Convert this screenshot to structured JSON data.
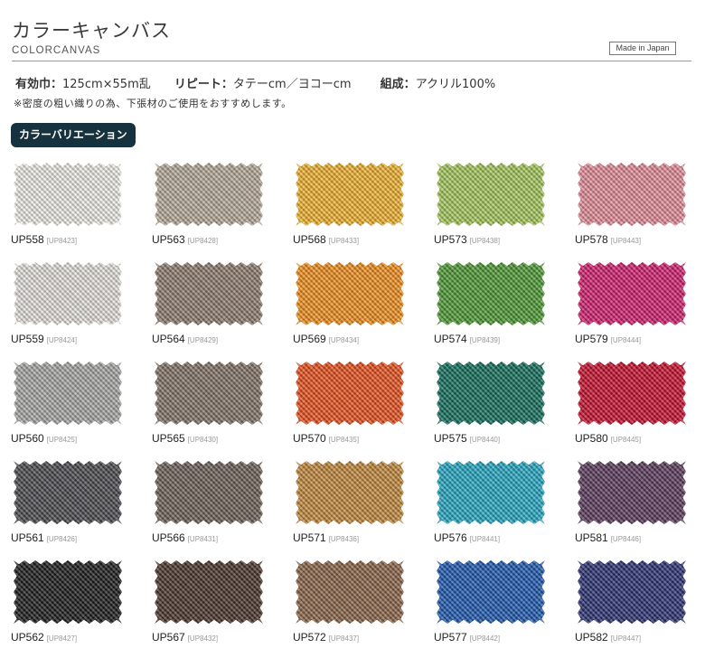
{
  "header": {
    "title": "カラーキャンバス",
    "subtitle": "COLORCANVAS",
    "badge": "Made in Japan"
  },
  "specs": {
    "width_label": "有効巾：",
    "width_value": "125cm×55m乱",
    "repeat_label": "リピート：",
    "repeat_value": "タテーcm／ヨコーcm",
    "composition_label": "組成：",
    "composition_value": "アクリル100%"
  },
  "note": "※密度の粗い織りの為、下張材のご使用をおすすめします。",
  "section_tab": "カラーバリエーション",
  "swatches": [
    {
      "code": "UP558",
      "sub": "[UP8423]",
      "color": "#f1efe9"
    },
    {
      "code": "UP563",
      "sub": "[UP8428]",
      "color": "#b8ab9b"
    },
    {
      "code": "UP568",
      "sub": "[UP8433]",
      "color": "#f2b431"
    },
    {
      "code": "UP573",
      "sub": "[UP8438]",
      "color": "#a6c95d"
    },
    {
      "code": "UP578",
      "sub": "[UP8443]",
      "color": "#e58e9b"
    },
    {
      "code": "UP559",
      "sub": "[UP8424]",
      "color": "#e7e4df"
    },
    {
      "code": "UP564",
      "sub": "[UP8429]",
      "color": "#8f7d70"
    },
    {
      "code": "UP569",
      "sub": "[UP8434]",
      "color": "#f2911f"
    },
    {
      "code": "UP574",
      "sub": "[UP8439]",
      "color": "#4f9a35"
    },
    {
      "code": "UP579",
      "sub": "[UP8444]",
      "color": "#d3206f"
    },
    {
      "code": "UP560",
      "sub": "[UP8425]",
      "color": "#a9a9a6"
    },
    {
      "code": "UP565",
      "sub": "[UP8430]",
      "color": "#837468"
    },
    {
      "code": "UP570",
      "sub": "[UP8435]",
      "color": "#e9521f"
    },
    {
      "code": "UP575",
      "sub": "[UP8440]",
      "color": "#13705c"
    },
    {
      "code": "UP580",
      "sub": "[UP8445]",
      "color": "#c8102e"
    },
    {
      "code": "UP561",
      "sub": "[UP8426]",
      "color": "#4b4b4f"
    },
    {
      "code": "UP566",
      "sub": "[UP8431]",
      "color": "#6d6257"
    },
    {
      "code": "UP571",
      "sub": "[UP8436]",
      "color": "#c48a3e"
    },
    {
      "code": "UP576",
      "sub": "[UP8441]",
      "color": "#25a9c2"
    },
    {
      "code": "UP581",
      "sub": "[UP8446]",
      "color": "#5b3b5c"
    },
    {
      "code": "UP562",
      "sub": "[UP8427]",
      "color": "#1e1c1e"
    },
    {
      "code": "UP567",
      "sub": "[UP8432]",
      "color": "#4a352c"
    },
    {
      "code": "UP572",
      "sub": "[UP8437]",
      "color": "#8b6549"
    },
    {
      "code": "UP577",
      "sub": "[UP8442]",
      "color": "#1f59b0"
    },
    {
      "code": "UP582",
      "sub": "[UP8447]",
      "color": "#2b3273"
    }
  ]
}
